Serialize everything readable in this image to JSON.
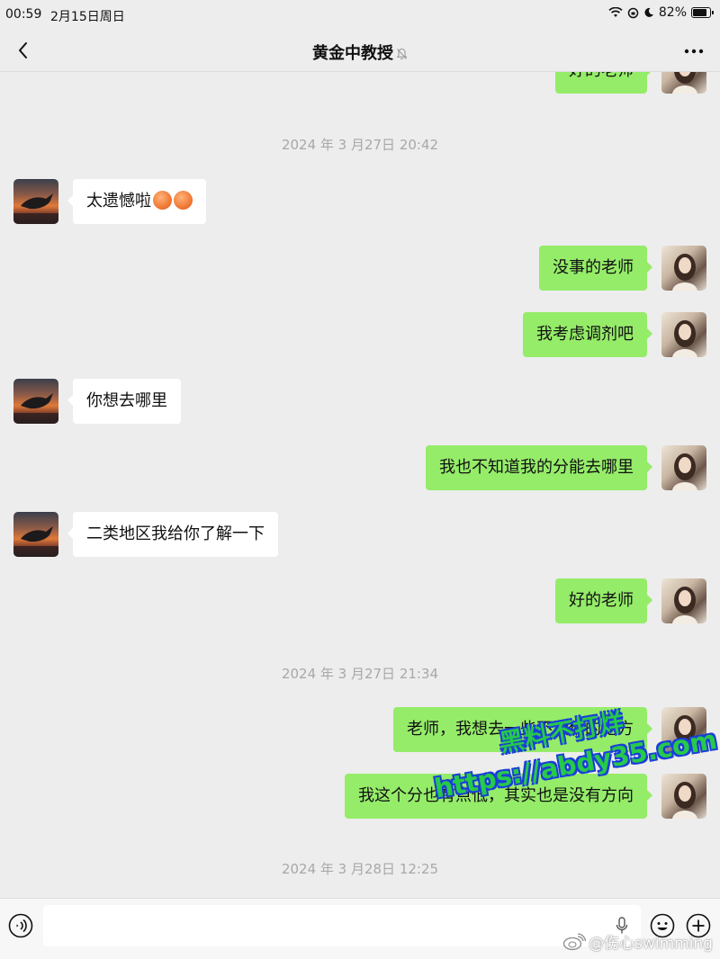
{
  "status_bar": {
    "time": "00:59",
    "date": "2月15日周日",
    "battery": "82%",
    "battery_level": 0.82
  },
  "header": {
    "title": "黄金中教授",
    "muted": true
  },
  "messages": [
    {
      "type": "outgoing",
      "text": "好的老师"
    },
    {
      "type": "timestamp",
      "text": "2024 年 3 月27日 20:42"
    },
    {
      "type": "incoming",
      "text": "太遗憾啦",
      "emoji_count": 2
    },
    {
      "type": "outgoing",
      "text": "没事的老师"
    },
    {
      "type": "outgoing",
      "text": "我考虑调剂吧"
    },
    {
      "type": "incoming",
      "text": "你想去哪里"
    },
    {
      "type": "outgoing",
      "text": "我也不知道我的分能去哪里"
    },
    {
      "type": "incoming",
      "text": "二类地区我给你了解一下"
    },
    {
      "type": "outgoing",
      "text": "好的老师"
    },
    {
      "type": "timestamp",
      "text": "2024 年 3 月27日 21:34"
    },
    {
      "type": "outgoing",
      "text": "老师，我想去一些不太偏的地方"
    },
    {
      "type": "outgoing",
      "text": "我这个分也有点低，其实也是没有方向"
    },
    {
      "type": "timestamp",
      "text": "2024 年 3 月28日 12:25"
    }
  ],
  "input_bar": {
    "value": "",
    "placeholder": ""
  },
  "watermark": {
    "line1": "黑料不打烊",
    "line2": "https://abdy35.com"
  },
  "weibo_mark": "@伤心swimming",
  "colors": {
    "background": "#ededed",
    "outgoing_bubble": "#95ec69",
    "incoming_bubble": "#ffffff",
    "timestamp_text": "#a8a8a8"
  },
  "icons": [
    "back-arrow-icon",
    "mute-bell-icon",
    "more-dots-icon",
    "voice-icon",
    "mic-icon",
    "emoji-face-icon",
    "plus-icon",
    "wifi-icon",
    "moon-icon",
    "battery-icon"
  ]
}
